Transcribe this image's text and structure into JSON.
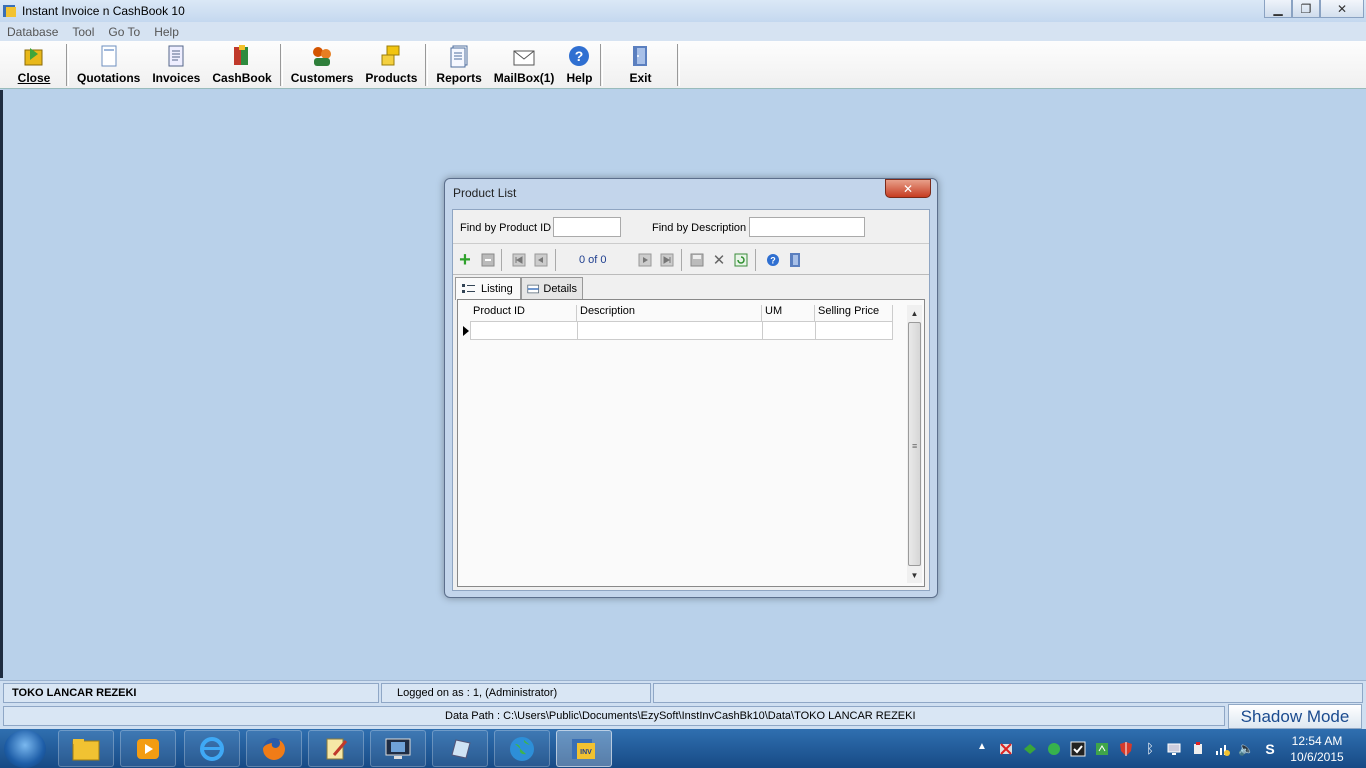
{
  "window": {
    "title": "Instant Invoice n CashBook 10"
  },
  "menu": [
    "Database",
    "Tool",
    "Go To",
    "Help"
  ],
  "toolbar": {
    "close": "Close",
    "quotations": "Quotations",
    "invoices": "Invoices",
    "cashbook": "CashBook",
    "customers": "Customers",
    "products": "Products",
    "reports": "Reports",
    "mailbox": "MailBox(1)",
    "help": "Help",
    "exit": "Exit"
  },
  "dialog": {
    "title": "Product List",
    "find_by_id_label": "Find by Product ID",
    "find_by_id_value": "",
    "find_by_desc_label": "Find by Description",
    "find_by_desc_value": "",
    "record_position": "0 of 0",
    "tabs": [
      "Listing",
      "Details"
    ],
    "grid": {
      "columns": [
        "Product ID",
        "Description",
        "UM",
        "Selling Price"
      ]
    }
  },
  "status": {
    "company": "TOKO LANCAR REZEKI",
    "logged_on": "Logged on as : 1, (Administrator)",
    "data_path": "Data Path : C:\\Users\\Public\\Documents\\EzySoft\\InstInvCashBk10\\Data\\TOKO LANCAR REZEKI",
    "shadow_mode": "Shadow Mode"
  },
  "taskbar": {
    "time": "12:54 AM",
    "date": "10/6/2015"
  }
}
